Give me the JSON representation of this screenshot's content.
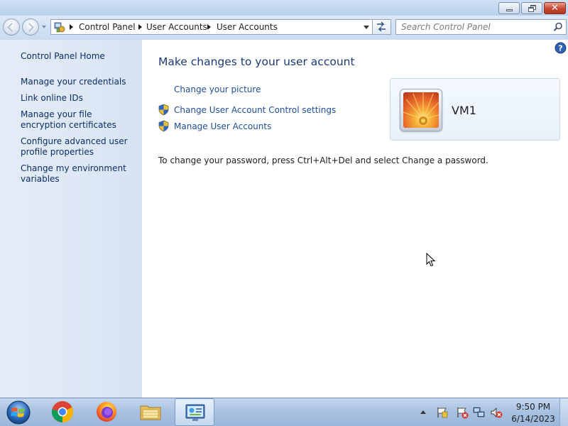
{
  "window": {
    "minimize_icon": "minimize-icon",
    "maximize_icon": "restore-icon",
    "close_icon": "close-icon",
    "close_glyph": "✕"
  },
  "navbar": {
    "breadcrumb": [
      "Control Panel",
      "User Accounts",
      "User Accounts"
    ],
    "search_placeholder": "Search Control Panel"
  },
  "sidebar": {
    "home": "Control Panel Home",
    "links": [
      "Manage your credentials",
      "Link online IDs",
      "Manage your file encryption certificates",
      "Configure advanced user profile properties",
      "Change my environment variables"
    ]
  },
  "main": {
    "title": "Make changes to your user account",
    "tasks": [
      "Change your picture",
      "Change User Account Control settings",
      "Manage User Accounts"
    ],
    "password_note": "To change your password, press Ctrl+Alt+Del and select Change a password.",
    "user": {
      "name": "VM1",
      "picture": "orange-flower-picture"
    }
  },
  "taskbar": {
    "apps": [
      "chrome",
      "firefox",
      "file-explorer",
      "control-panel"
    ],
    "active_app": "control-panel",
    "clock": {
      "time": "9:50 PM",
      "date": "6/14/2023"
    }
  },
  "colors": {
    "link": "#1f4e9c",
    "sidebar_link": "#0d2d66",
    "title": "#1a3a7a"
  }
}
